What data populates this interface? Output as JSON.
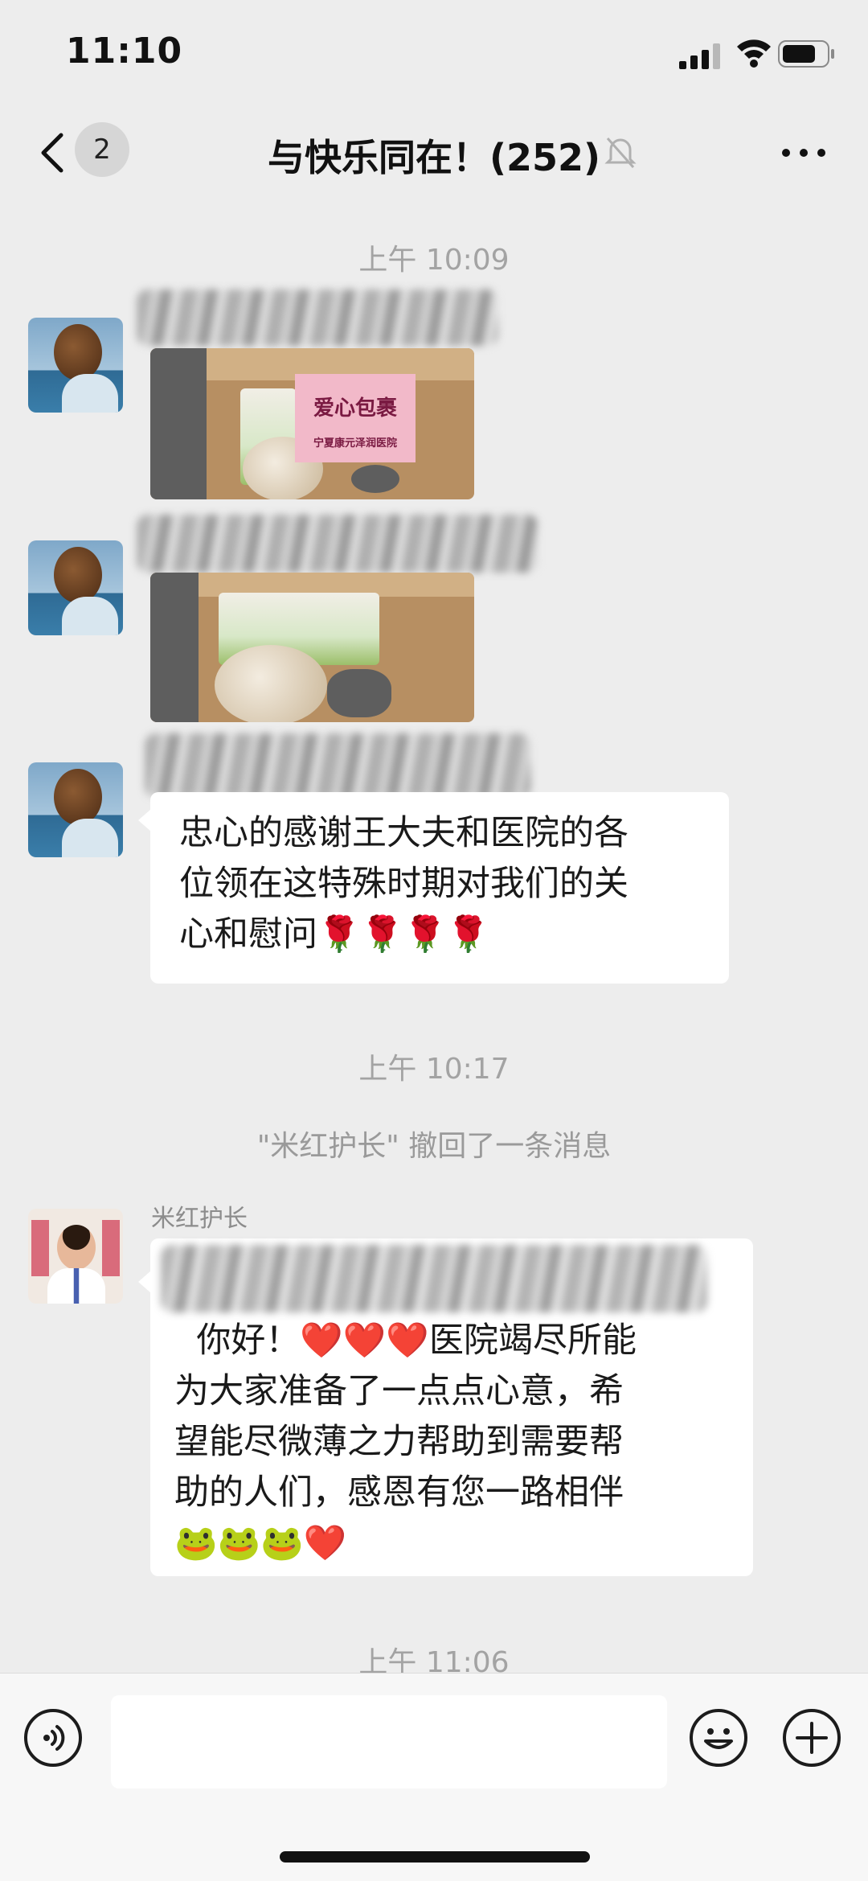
{
  "status_bar": {
    "time": "11:10"
  },
  "header": {
    "back_badge": "2",
    "title": "与快乐同在！(252)"
  },
  "messages": {
    "time_1": "上午 10:09",
    "photo_label_1": "爱心包裹",
    "photo_label_2": "宁夏康元泽润医院",
    "text_1": "忠心的感谢王大夫和医院的各\n位领在这特殊时期对我们的关\n心和慰问🌹🌹🌹🌹",
    "time_2": "上午 10:17",
    "recall_notice": "\"米红护长\" 撤回了一条消息",
    "sender_name": "米红护长",
    "text_2": "  你好！❤️❤️❤️医院竭尽所能\n为大家准备了一点点心意，希\n望能尽微薄之力帮助到需要帮\n助的人们，感恩有您一路相伴\n🐸🐸🐸❤️",
    "time_3": "上午 11:06"
  },
  "icons": [
    "back-icon",
    "mute-icon",
    "more-icon",
    "voice-icon",
    "emoji-icon",
    "plus-icon",
    "signal-icon",
    "wifi-icon",
    "battery-icon"
  ]
}
